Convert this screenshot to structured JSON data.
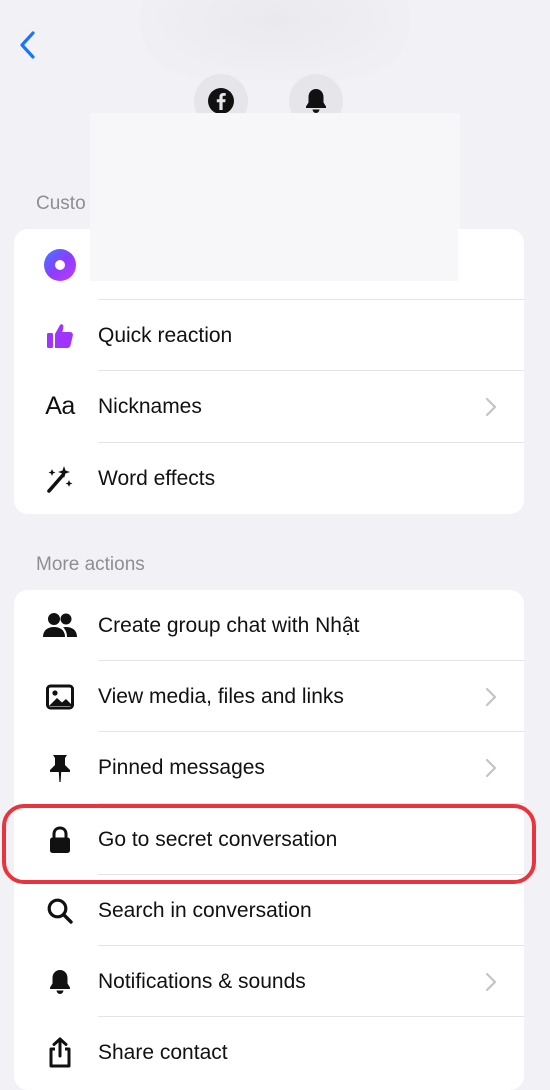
{
  "header": {
    "back_icon": "chevron-left-icon",
    "facebook_button_icon": "facebook-icon",
    "notifications_button_icon": "bell-icon"
  },
  "customization": {
    "section_label": "Custo",
    "items": [
      {
        "label": "",
        "icon": "theme-circle-icon",
        "chevron": false
      },
      {
        "label": "Quick reaction",
        "icon": "thumbs-up-icon",
        "chevron": false
      },
      {
        "label": "Nicknames",
        "icon": "text-aa-icon",
        "icon_text": "Aa",
        "chevron": true
      },
      {
        "label": "Word effects",
        "icon": "magic-wand-icon",
        "chevron": false
      }
    ]
  },
  "more_actions": {
    "section_label": "More actions",
    "items": [
      {
        "label": "Create group chat with Nhật",
        "icon": "people-icon",
        "chevron": false
      },
      {
        "label": "View media, files and links",
        "icon": "image-icon",
        "chevron": true
      },
      {
        "label": "Pinned messages",
        "icon": "pin-icon",
        "chevron": true
      },
      {
        "label": "Go to secret conversation",
        "icon": "lock-icon",
        "chevron": false,
        "highlighted": true
      },
      {
        "label": "Search in conversation",
        "icon": "search-icon",
        "chevron": false
      },
      {
        "label": "Notifications & sounds",
        "icon": "bell-icon",
        "chevron": true
      },
      {
        "label": "Share contact",
        "icon": "share-icon",
        "chevron": false
      }
    ]
  },
  "colors": {
    "accent_blue": "#1877f2",
    "highlight_red": "#e8353d",
    "reaction_purple": "#a033ff",
    "background": "#f2f2f6"
  }
}
